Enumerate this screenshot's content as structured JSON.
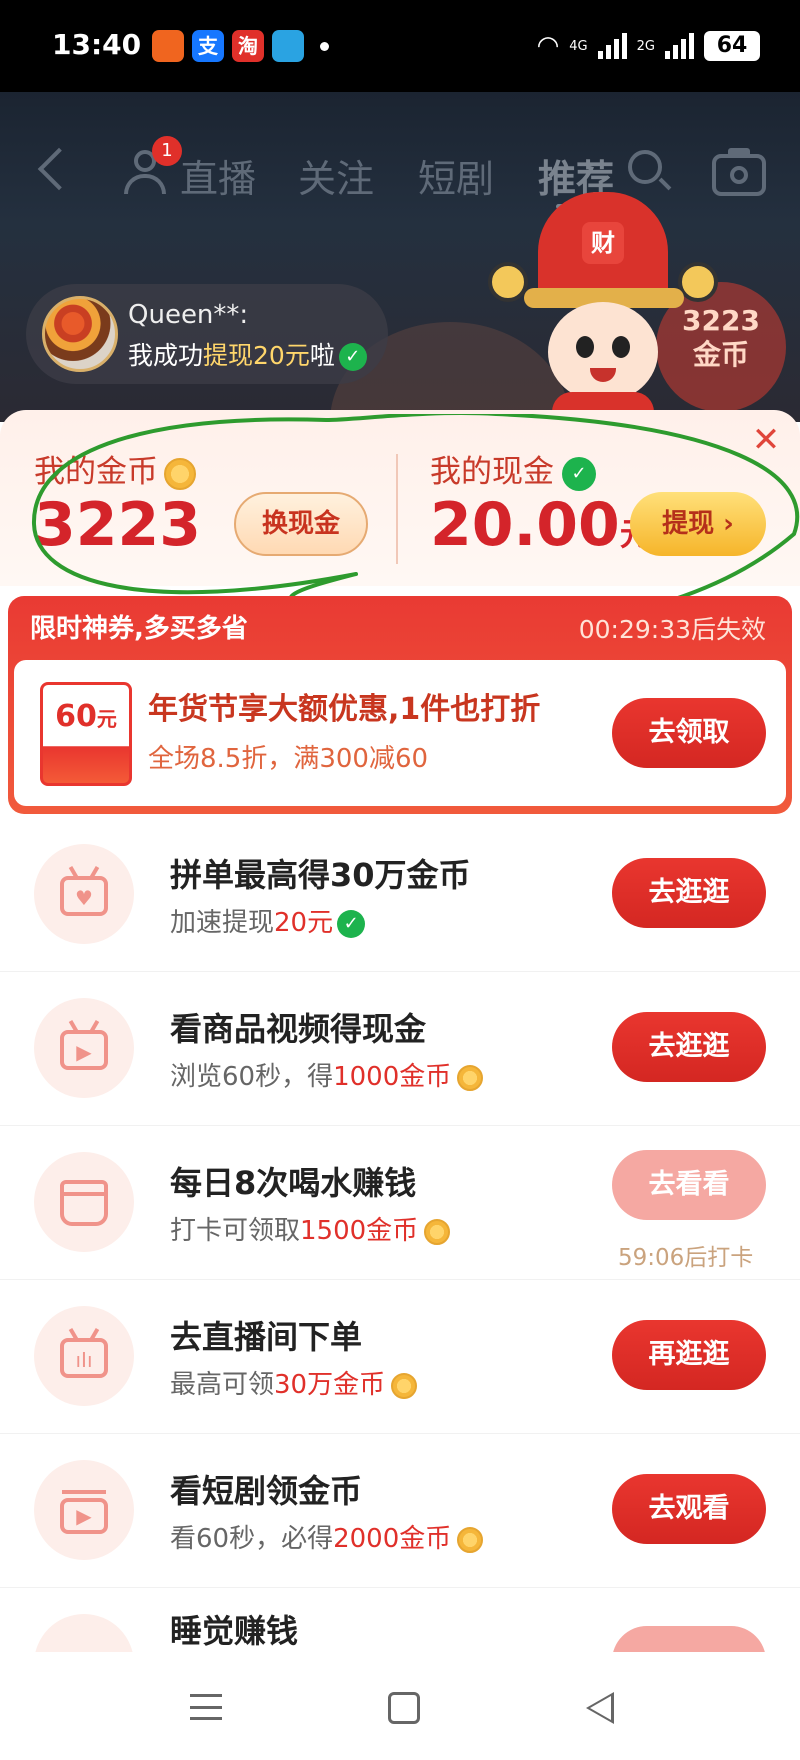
{
  "status_bar": {
    "time": "13:40",
    "apps": [
      {
        "icon": "orange-app-icon",
        "label": "",
        "color": "#f0651f"
      },
      {
        "icon": "alipay-icon",
        "label": "支",
        "color": "#1677ff"
      },
      {
        "icon": "taobao-icon",
        "label": "淘",
        "color": "#e0302a"
      },
      {
        "icon": "telegram-icon",
        "label": "",
        "color": "#2aa3e2"
      }
    ],
    "signal1": "4G",
    "signal2": "2G",
    "battery": "64"
  },
  "top_nav": {
    "badge_count": "1",
    "tabs": [
      "直播",
      "关注",
      "短剧",
      "推荐"
    ],
    "active_tab": "推荐"
  },
  "notice": {
    "user": "Queen**:",
    "msg_prefix": "我成功",
    "msg_highlight": "提现20元",
    "msg_suffix": "啦"
  },
  "mascot": {
    "hat_char": "财"
  },
  "coin_peek": {
    "line1": "3223",
    "line2": "金币"
  },
  "wallet": {
    "coins_label": "我的金币",
    "coins_value": "3223",
    "exchange_label": "换现金",
    "cash_label": "我的现金",
    "cash_value": "20.00",
    "cash_unit": "元",
    "withdraw_label": "提现 ›",
    "close": "✕",
    "accent_color": "#d4242a"
  },
  "coupon": {
    "header": "限时神券,多买多省",
    "timer": "00:29:33后失效",
    "amount": "60",
    "amount_unit": "元",
    "title": "年货节享大额优惠,1件也打折",
    "subtitle": "全场8.5折，满300减60",
    "button": "去领取"
  },
  "tasks": [
    {
      "icon": "tv-heart-icon",
      "glyph": "♥",
      "title": "拼单最高得30万金币",
      "sub_prefix": "加速提现",
      "sub_highlight": "20元",
      "sub_icon": "check-icon",
      "button": "去逛逛",
      "disabled": false,
      "countdown": ""
    },
    {
      "icon": "tv-play-icon",
      "glyph": "▶",
      "title": "看商品视频得现金",
      "sub_prefix": "浏览60秒，得",
      "sub_highlight": "1000金币",
      "sub_icon": "coin-icon",
      "button": "去逛逛",
      "disabled": false,
      "countdown": ""
    },
    {
      "icon": "cup-icon",
      "glyph": "",
      "title": "每日8次喝水赚钱",
      "sub_prefix": "打卡可领取",
      "sub_highlight": "1500金币",
      "sub_icon": "coin-icon",
      "button": "去看看",
      "disabled": true,
      "countdown": "59:06后打卡"
    },
    {
      "icon": "tv-bars-icon",
      "glyph": "ıIı",
      "title": "去直播间下单",
      "sub_prefix": "最高可领",
      "sub_highlight": "30万金币",
      "sub_icon": "coin-icon",
      "button": "再逛逛",
      "disabled": false,
      "countdown": ""
    },
    {
      "icon": "screen-play-icon",
      "glyph": "▶",
      "title": "看短剧领金币",
      "sub_prefix": "看60秒，必得",
      "sub_highlight": "2000金币",
      "sub_icon": "coin-icon",
      "button": "去观看",
      "disabled": false,
      "countdown": ""
    },
    {
      "icon": "sleep-icon",
      "glyph": "",
      "title": "睡觉赚钱",
      "sub_prefix": "",
      "sub_highlight": "",
      "sub_icon": "",
      "button": "",
      "disabled": true,
      "countdown": ""
    }
  ]
}
